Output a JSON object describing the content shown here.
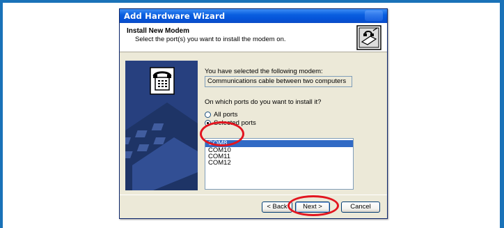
{
  "window": {
    "title": "Add Hardware Wizard"
  },
  "header": {
    "title": "Install New Modem",
    "subtitle": "Select the port(s) you want to install the modem on."
  },
  "content": {
    "selected_label": "You have selected the following modem:",
    "modem_name": "Communications cable between two computers",
    "ports_question": "On which ports do you want to install it?",
    "radio_all": "All ports",
    "radio_selected": "Selected ports",
    "radio_checked": "Selected ports",
    "ports": [
      "COM8",
      "COM10",
      "COM11",
      "COM12"
    ],
    "selected_port": "COM8"
  },
  "buttons": {
    "back": "< Back",
    "next": "Next >",
    "cancel": "Cancel"
  },
  "colors": {
    "titlebar": "#0554d9",
    "selection": "#316ac5",
    "annotation": "#e2151f",
    "page_border": "#1a72b8"
  },
  "icons": {
    "header": "modem-wizard-icon",
    "banner": "telephone-icon"
  }
}
